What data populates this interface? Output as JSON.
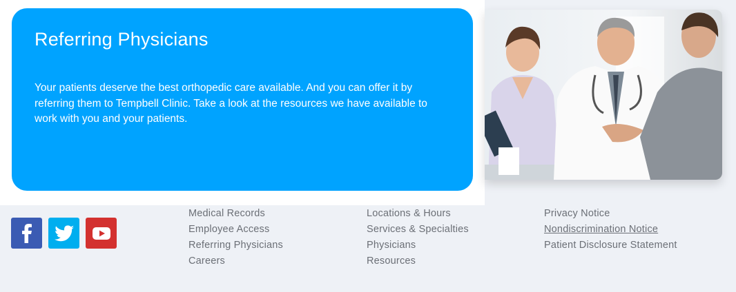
{
  "promo": {
    "title": "Referring Physicians",
    "body": "Your patients deserve the best orthopedic care available. And you can offer it by referring them to Tempbell Clinic. Take a look at the resources we have available to work with you and your patients."
  },
  "social": [
    {
      "name": "facebook-icon"
    },
    {
      "name": "twitter-icon"
    },
    {
      "name": "youtube-icon"
    }
  ],
  "footer": {
    "col1": [
      "Medical Records",
      "Employee Access",
      "Referring Physicians",
      "Careers"
    ],
    "col2": [
      "Locations & Hours",
      "Services & Specialties",
      "Physicians",
      "Resources"
    ],
    "col3": [
      "Privacy Notice",
      "Nondiscrimination Notice",
      "Patient Disclosure Statement"
    ]
  },
  "colors": {
    "promo_bg": "#00a3ff",
    "facebook": "#3b5bb3",
    "twitter": "#00aeef",
    "youtube": "#d3312f",
    "footer_bg": "#eef1f6"
  }
}
